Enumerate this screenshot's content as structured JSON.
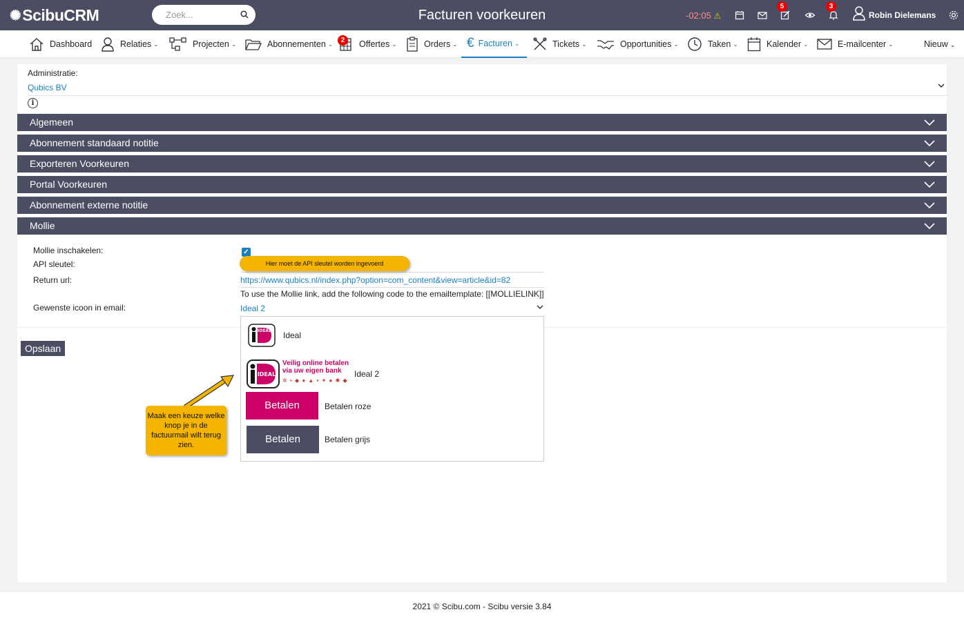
{
  "app": {
    "logo": "ScibuCRM",
    "page_title": "Facturen voorkeuren"
  },
  "search": {
    "placeholder": "Zoek..."
  },
  "topbar": {
    "timer": "-02:05",
    "badge_notes": "5",
    "badge_bell": "3",
    "user_name": "Robin Dielemans"
  },
  "nav": {
    "items": [
      {
        "label": "Dashboard",
        "icon": "home-icon"
      },
      {
        "label": "Relaties",
        "icon": "user-icon"
      },
      {
        "label": "Projecten",
        "icon": "project-icon"
      },
      {
        "label": "Abonnementen",
        "icon": "folder-icon"
      },
      {
        "label": "Offertes",
        "icon": "calculator-icon",
        "badge": "2"
      },
      {
        "label": "Orders",
        "icon": "clipboard-icon"
      },
      {
        "label": "Facturen",
        "icon": "euro-icon",
        "active": true
      },
      {
        "label": "Tickets",
        "icon": "tools-icon"
      },
      {
        "label": "Opportunities",
        "icon": "handshake-icon"
      },
      {
        "label": "Taken",
        "icon": "clock-icon"
      },
      {
        "label": "Kalender",
        "icon": "calendar-icon"
      },
      {
        "label": "E-mailcenter",
        "icon": "mail-icon"
      }
    ],
    "nieuw": "Nieuw"
  },
  "administratie": {
    "label": "Administratie:",
    "value": "Qubics BV"
  },
  "sections": [
    "Algemeen",
    "Abonnement standaard notitie",
    "Exporteren Voorkeuren",
    "Portal Voorkeuren",
    "Abonnement externe notitie",
    "Mollie"
  ],
  "mollie": {
    "enable_label": "Mollie inschakelen:",
    "enabled": true,
    "api_label": "API sleutel:",
    "return_label": "Return url:",
    "return_url": "https://www.qubics.nl/index.php?option=com_content&view=article&id=82",
    "note": "To use the Mollie link, add the following code to the emailtemplate: [[MOLLIELINK]]",
    "icon_label": "Gewenste icoon in email:",
    "icon_value": "Ideal 2",
    "options": [
      {
        "label": "Ideal"
      },
      {
        "label": "Ideal 2",
        "tagline": "Veilig online betalen via uw eigen bank"
      },
      {
        "label": "Betalen roze",
        "button": "Betalen"
      },
      {
        "label": "Betalen grijs",
        "button": "Betalen"
      }
    ]
  },
  "buttons": {
    "save": "Opslaan"
  },
  "tooltips": {
    "api": "Hier moet de API sleutel worden ingevoerd",
    "keuze": "Maak een keuze welke knop je in de factuurmail wilt terug zien."
  },
  "footer": "2021 © Scibu.com - Scibu versie 3.84",
  "colors": {
    "header": "#4b4e63",
    "accent": "#1a7fc1",
    "ideal_pink": "#cc0066",
    "tooltip": "#f5b400"
  }
}
